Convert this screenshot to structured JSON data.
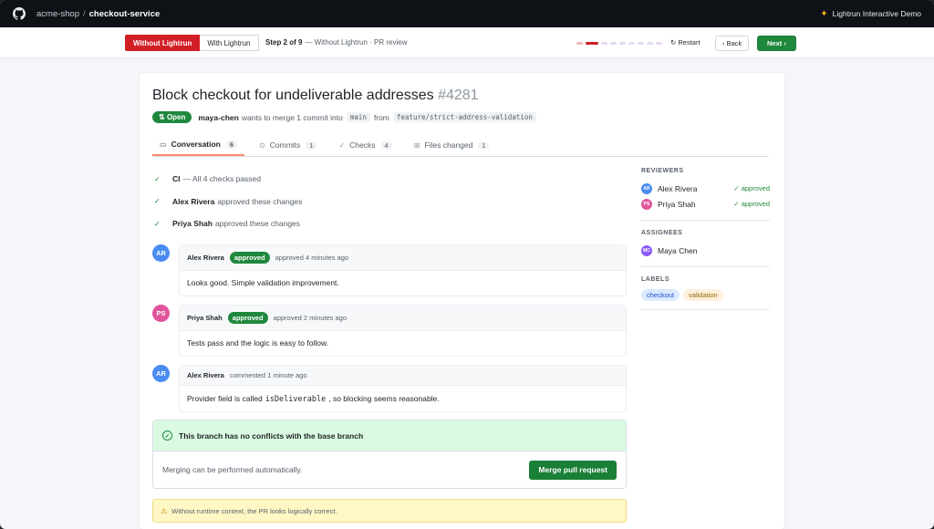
{
  "topbar": {
    "org": "acme-shop",
    "separator": "/",
    "repo": "checkout-service",
    "brand": "Lightrun Interactive Demo"
  },
  "stepbar": {
    "mode_active": "Without Lightrun",
    "mode_inactive": "With Lightrun",
    "step_label": "Step 2 of 9",
    "step_desc": "— Without Lightrun · PR review",
    "total_steps": 9,
    "current_step": 2,
    "restart_label": "Restart",
    "back_label": "Back",
    "next_label": "Next"
  },
  "pr": {
    "title": "Block checkout for undeliverable addresses",
    "number": "#4281",
    "status": "Open",
    "author": "maya-chen",
    "merge_text": "wants to merge 1 commit into",
    "base_branch": "main",
    "from_text": "from",
    "head_branch": "feature/strict-address-validation"
  },
  "tabs": [
    {
      "label": "Conversation",
      "count": "6"
    },
    {
      "label": "Commits",
      "count": "1"
    },
    {
      "label": "Checks",
      "count": "4"
    },
    {
      "label": "Files changed",
      "count": "1"
    }
  ],
  "checks": [
    {
      "bold": "CI",
      "text": "— All 4 checks passed"
    },
    {
      "bold": "Alex Rivera",
      "text": "approved these changes"
    },
    {
      "bold": "Priya Shah",
      "text": "approved these changes"
    }
  ],
  "comments": [
    {
      "initials": "AR",
      "author": "Alex Rivera",
      "badge": "approved",
      "meta": "approved 4 minutes ago",
      "body": "Looks good. Simple validation improvement."
    },
    {
      "initials": "PS",
      "author": "Priya Shah",
      "badge": "approved",
      "meta": "approved 2 minutes ago",
      "body": "Tests pass and the logic is easy to follow."
    },
    {
      "initials": "AR",
      "author": "Alex Rivera",
      "meta": "commented 1 minute ago",
      "body_pre": "Provider field is called",
      "body_code": "isDeliverable",
      "body_post": ", so blocking seems reasonable."
    }
  ],
  "merge": {
    "status": "This branch has no conflicts with the base branch",
    "info": "Merging can be performed automatically.",
    "button": "Merge pull request"
  },
  "warning": "Without runtime context, the PR looks logically correct.",
  "sidebar": {
    "reviewers_title": "REVIEWERS",
    "reviewers": [
      {
        "initials": "AR",
        "name": "Alex Rivera",
        "status": "✓ approved"
      },
      {
        "initials": "PS",
        "name": "Priya Shah",
        "status": "✓ approved"
      }
    ],
    "assignees_title": "ASSIGNEES",
    "assignees": [
      {
        "initials": "MC",
        "name": "Maya Chen"
      }
    ],
    "labels_title": "LABELS",
    "labels": [
      "checkout",
      "validation"
    ]
  },
  "colors": {
    "accent_red": "#d21f26",
    "success_green": "#1f883d",
    "avatar_ar": "#4a8cf0",
    "avatar_ps": "#e0559b",
    "avatar_mc": "#8b5cf6",
    "label_checkout_bg": "#dbeafe",
    "label_validation_bg": "#fdf0dc"
  }
}
